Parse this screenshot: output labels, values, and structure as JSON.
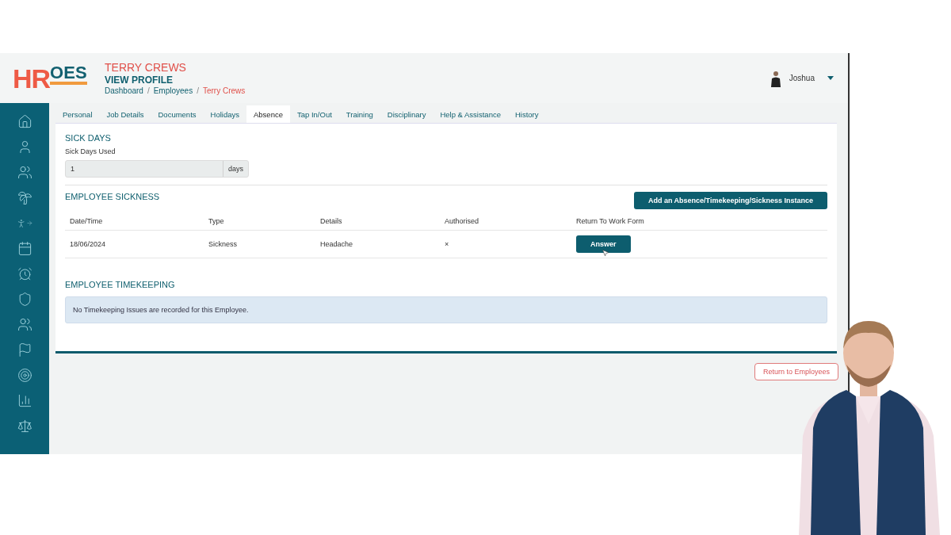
{
  "logo": {
    "part_1": "HR",
    "part_2": "OES"
  },
  "header": {
    "name": "TERRY CREWS",
    "subtitle": "VIEW PROFILE",
    "separator": "/",
    "breadcrumb": [
      {
        "label": "Dashboard",
        "current": false
      },
      {
        "label": "Employees",
        "current": false
      },
      {
        "label": "Terry Crews",
        "current": true
      }
    ]
  },
  "user": {
    "name": "Joshua"
  },
  "tabs": [
    {
      "label": "Personal",
      "selected": false
    },
    {
      "label": "Job Details",
      "selected": false
    },
    {
      "label": "Documents",
      "selected": false
    },
    {
      "label": "Holidays",
      "selected": false
    },
    {
      "label": "Absence",
      "selected": true
    },
    {
      "label": "Tap In/Out",
      "selected": false
    },
    {
      "label": "Training",
      "selected": false
    },
    {
      "label": "Disciplinary",
      "selected": false
    },
    {
      "label": "Help & Assistance",
      "selected": false
    },
    {
      "label": "History",
      "selected": false
    }
  ],
  "sick_days": {
    "title": "SICK DAYS",
    "label": "Sick Days Used",
    "value": "1",
    "unit": "days"
  },
  "sickness": {
    "title": "EMPLOYEE SICKNESS",
    "add_button": "Add an Absence/Timekeeping/Sickness Instance",
    "columns": [
      "Date/Time",
      "Type",
      "Details",
      "Authorised",
      "Return To Work Form"
    ],
    "rows": [
      {
        "date": "18/06/2024",
        "type": "Sickness",
        "details": "Headache",
        "authorised": "×",
        "action": "Answer"
      }
    ]
  },
  "timekeeping": {
    "title": "EMPLOYEE TIMEKEEPING",
    "message": "No Timekeeping Issues are recorded for this Employee."
  },
  "return_button": "Return to Employees"
}
